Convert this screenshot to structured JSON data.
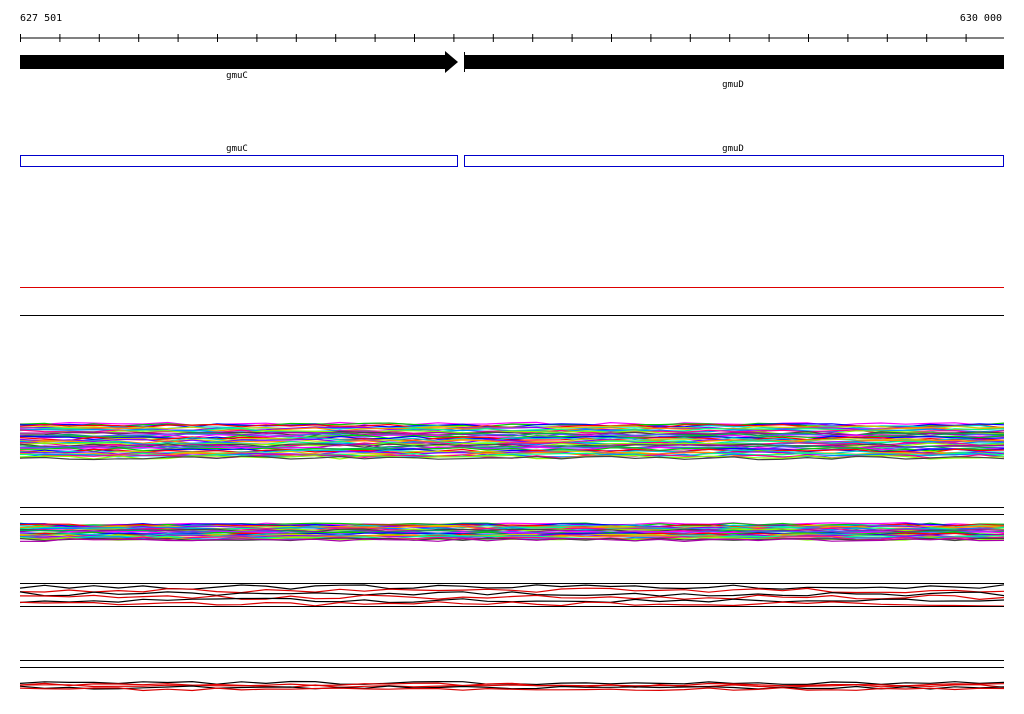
{
  "ruler": {
    "start_label": "627 501",
    "end_label": "630 000",
    "start": 627501,
    "end": 630000
  },
  "genes": [
    {
      "name": "gmuC",
      "strand": "+"
    },
    {
      "name": "gmuD",
      "strand": "+"
    }
  ],
  "annotations": [
    {
      "name": "gmuC"
    },
    {
      "name": "gmuD"
    }
  ],
  "colors": {
    "gene_fill": "#000000",
    "annotation_border": "#0000cc",
    "separator_red": "#dd0000",
    "track_line": "#000000",
    "background": "#ffffff"
  },
  "tracks": [
    {
      "id": "expression-track-1",
      "description_only": true
    },
    {
      "id": "expression-track-2",
      "description_only": true
    },
    {
      "id": "expression-track-3",
      "description_only": true
    },
    {
      "id": "expression-track-4",
      "description_only": true
    }
  ]
}
